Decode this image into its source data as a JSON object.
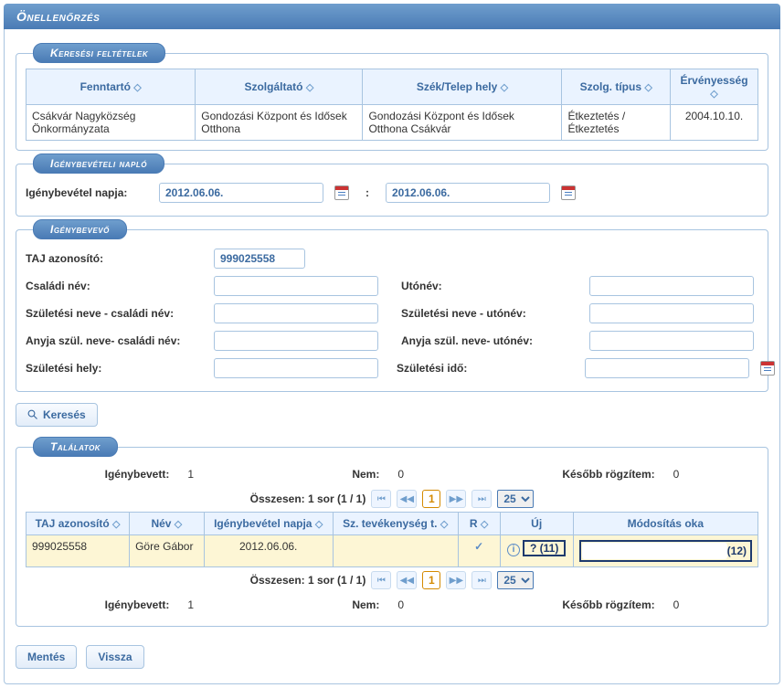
{
  "page_title": "Önellenőrzés",
  "sections": {
    "search_criteria": "Keresési feltételek",
    "usage_log": "Igénybevételi napló",
    "recipient": "Igénybevevő",
    "results": "Találatok"
  },
  "criteria_table": {
    "headers": [
      "Fenntartó",
      "Szolgáltató",
      "Szék/Telep hely",
      "Szolg. típus",
      "Érvényesség"
    ],
    "row": [
      "Csákvár Nagyközség Önkormányzata",
      "Gondozási Központ és Idősek Otthona",
      "Gondozási Központ és Idősek Otthona Csákvár",
      "Étkeztetés / Étkeztetés",
      "2004.10.10."
    ]
  },
  "usage_log": {
    "label": "Igénybevétel napja:",
    "date_from": "2012.06.06.",
    "separator": ":",
    "date_to": "2012.06.06."
  },
  "recipient": {
    "taj_label": "TAJ azonosító:",
    "taj_value": "999025558",
    "family_name_label": "Családi név:",
    "first_name_label": "Utónév:",
    "birth_family_label": "Születési neve - családi név:",
    "birth_first_label": "Születési neve - utónév:",
    "mother_family_label": "Anyja szül. neve- családi név:",
    "mother_first_label": "Anyja szül. neve- utónév:",
    "birth_place_label": "Születési hely:",
    "birth_date_label": "Születési idő:"
  },
  "search_button": "Keresés",
  "results": {
    "summary_labels": {
      "used": "Igénybevett:",
      "not": "Nem:",
      "later": "Később rögzítem:"
    },
    "summary_values": {
      "used": "1",
      "not": "0",
      "later": "0"
    },
    "total_text": "Összesen: 1 sor (1 / 1)",
    "page_current": "1",
    "page_size": "25",
    "headers": [
      "TAJ azonosító",
      "Név",
      "Igénybevétel napja",
      "Sz. tevékenység t.",
      "R",
      "Új",
      "Módosítás oka"
    ],
    "row": {
      "taj": "999025558",
      "name": "Göre Gábor",
      "date": "2012.06.06.",
      "activity": "",
      "r": "✓",
      "uj_q": "?",
      "uj_num": "(11)",
      "mod_tag": "(12)"
    }
  },
  "buttons": {
    "save": "Mentés",
    "back": "Vissza"
  }
}
